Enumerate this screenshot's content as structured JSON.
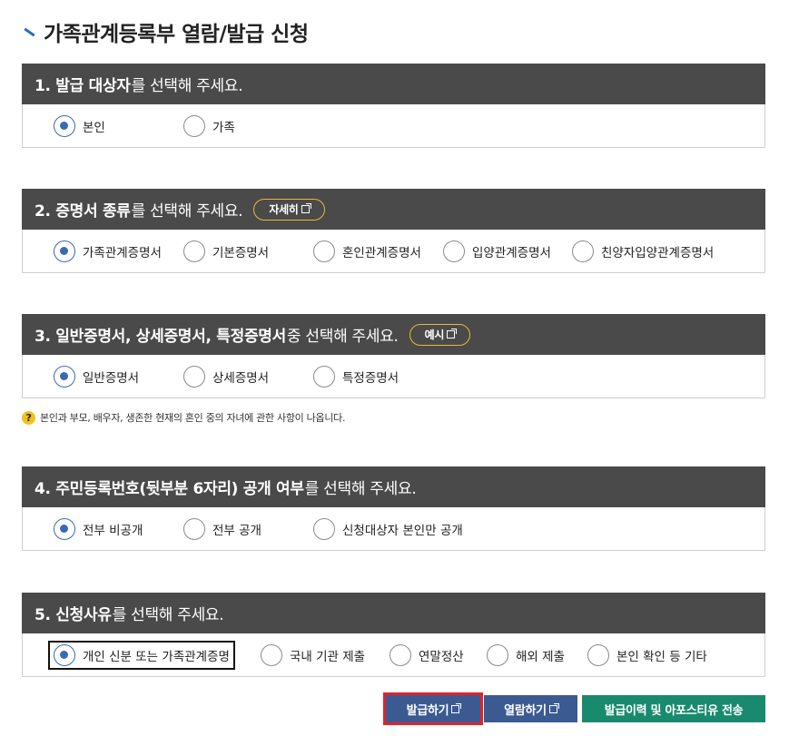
{
  "page_title": "가족관계등록부 열람/발급 신청",
  "sections": [
    {
      "head_bold": "1. 발급 대상자",
      "head_normal": "를 선택해 주세요.",
      "options": [
        "본인",
        "가족"
      ]
    },
    {
      "head_bold": "2. 증명서 종류",
      "head_normal": "를 선택해 주세요.",
      "pill_label": "자세히",
      "options": [
        "가족관계증명서",
        "기본증명서",
        "혼인관계증명서",
        "입양관계증명서",
        "친양자입양관계증명서"
      ]
    },
    {
      "head_bold": "3. 일반증명서, 상세증명서, 특정증명서",
      "head_normal": " 중 선택해 주세요.",
      "pill_label": "예시",
      "options": [
        "일반증명서",
        "상세증명서",
        "특정증명서"
      ]
    },
    {
      "head_bold": "4. 주민등록번호(뒷부분 6자리) 공개 여부",
      "head_normal": "를 선택해 주세요.",
      "options": [
        "전부 비공개",
        "전부 공개",
        "신청대상자 본인만 공개"
      ]
    },
    {
      "head_bold": "5. 신청사유",
      "head_normal": "를 선택해 주세요.",
      "options": [
        "개인 신분 또는 가족관계증명",
        "국내 기관 제출",
        "연말정산",
        "해외 제출",
        "본인 확인 등 기타"
      ]
    }
  ],
  "help_text": "본인과 부모, 배우자, 생존한 현재의 혼인 중의 자녀에 관한 사항이 나옵니다.",
  "help_icon": "?",
  "buttons": {
    "issue": "발급하기",
    "view": "열람하기",
    "history": "발급이력 및 아포스티유 전송"
  },
  "colors": {
    "header_bg": "#4a4a4a",
    "radio_checked": "#3a6ab0",
    "pill_border": "#e8b93a",
    "btn_primary": "#3c5a92",
    "btn_green": "#1a8a6e",
    "highlight": "#e0232b"
  }
}
